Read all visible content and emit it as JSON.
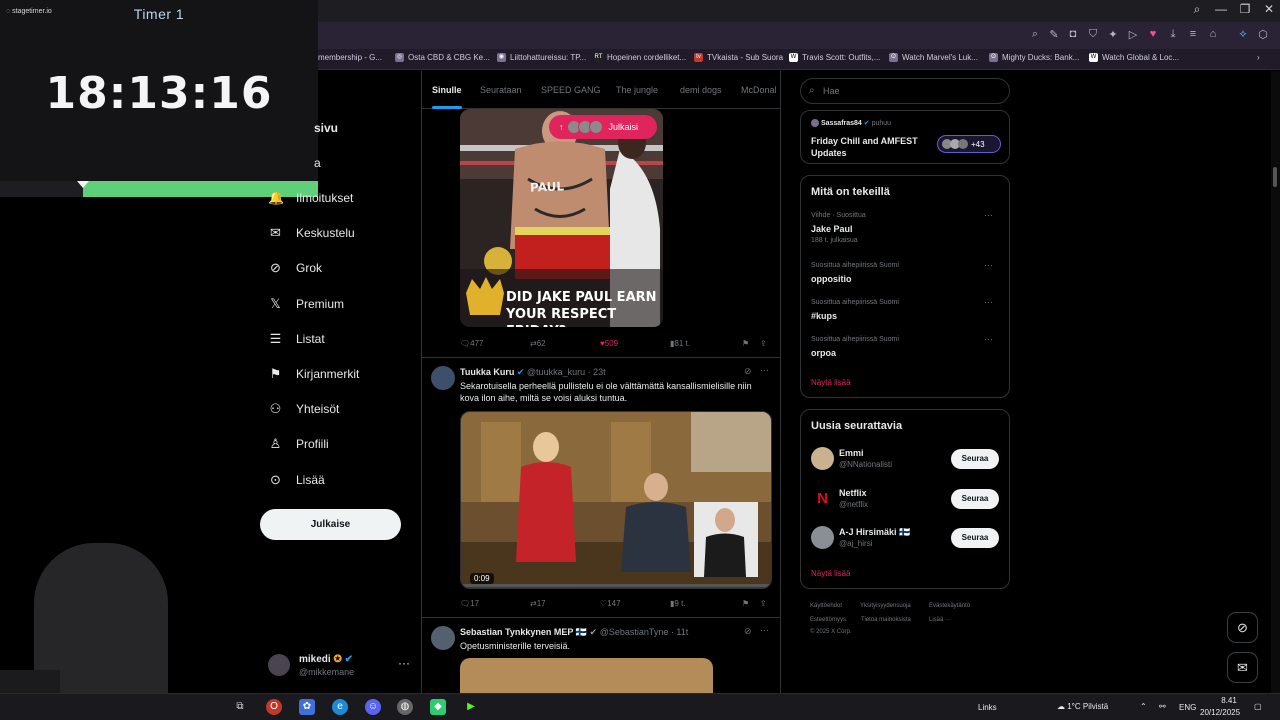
{
  "browser": {
    "bookmarks": [
      {
        "label": "membership - G..."
      },
      {
        "label": "Osta CBD & CBG Ke..."
      },
      {
        "label": "Liittohattureissu: TP..."
      },
      {
        "label": "Hopeinen cordelliket..."
      },
      {
        "label": "TVkaista - Sub Suora"
      },
      {
        "label": "Travis Scott: Outfits,..."
      },
      {
        "label": "Watch Marvel's Luk..."
      },
      {
        "label": "Mighty Ducks: Bank..."
      },
      {
        "label": "Watch Global & Loc..."
      }
    ],
    "window_controls": {
      "minimize": "—",
      "maximize": "❐",
      "close": "✕"
    }
  },
  "timer": {
    "brand": "stagetimer.io",
    "name": "Timer 1",
    "time": "18:13:16",
    "progress_fraction": 0.74,
    "accent_color": "#5fd07a"
  },
  "nav": {
    "partial_top": "sivu",
    "partial_second": "a",
    "items": [
      {
        "label": "Ilmoitukset",
        "icon": "bell-icon",
        "glyph": "🔔"
      },
      {
        "label": "Keskustelu",
        "icon": "mail-icon",
        "glyph": "✉"
      },
      {
        "label": "Grok",
        "icon": "grok-icon",
        "glyph": "⊘"
      },
      {
        "label": "Premium",
        "icon": "x-logo-icon",
        "glyph": "𝕏"
      },
      {
        "label": "Listat",
        "icon": "list-icon",
        "glyph": "☰"
      },
      {
        "label": "Kirjanmerkit",
        "icon": "bookmark-icon",
        "glyph": "⚑"
      },
      {
        "label": "Yhteisöt",
        "icon": "communities-icon",
        "glyph": "⚇"
      },
      {
        "label": "Profiili",
        "icon": "profile-icon",
        "glyph": "♙"
      },
      {
        "label": "Lisää",
        "icon": "more-circle-icon",
        "glyph": "⊙"
      }
    ],
    "post_button": "Julkaise",
    "account": {
      "name": "mikedi",
      "handle": "@mikkemane",
      "more": "···"
    }
  },
  "feed": {
    "tabs": [
      "Sinulle",
      "Seurataan",
      "SPEED GANG",
      "The jungle",
      "demi dogs",
      "McDonal"
    ],
    "new_posts_pill": "Julkaisi",
    "tweet1": {
      "image_caption_line1": "DID JAKE PAUL EARN",
      "image_caption_line2": "YOUR RESPECT FRIDAY?",
      "trunks_text": "PAUL",
      "replies": "477",
      "reposts": "62",
      "likes": "509",
      "views": "81 t."
    },
    "tweet2": {
      "name": "Tuukka Kuru",
      "handle": "@tuukka_kuru · 23t",
      "text": "Sekarotuisella perheellä pullistelu ei ole välttämättä kansallismielisille niin kova ilon aihe, miltä se voisi aluksi tuntua.",
      "video_time": "0:09",
      "replies": "17",
      "reposts": "17",
      "likes": "147",
      "views": "9 t."
    },
    "tweet3": {
      "name": "Sebastian Tynkkynen MEP",
      "flag": "🇫🇮",
      "handle": "@SebastianTyne · 11t",
      "text": "Opetusministerille terveisiä."
    }
  },
  "right": {
    "search_placeholder": "Hae",
    "space": {
      "host": "Sassafras84",
      "host_status": "puhuu",
      "title_line1": "Friday Chill and AMFEST",
      "title_line2": "Updates",
      "listeners": "+43"
    },
    "trends_title": "Mitä on tekeillä",
    "trends": [
      {
        "context": "Viihde · Suosittua",
        "name": "Jake Paul",
        "count": "188 t. julkaisua"
      },
      {
        "context": "Suosittua aihepiirissä Suomi",
        "name": "oppositio",
        "count": ""
      },
      {
        "context": "Suosittua aihepiirissä Suomi",
        "name": "#kups",
        "count": ""
      },
      {
        "context": "Suosittua aihepiirissä Suomi",
        "name": "orpoa",
        "count": ""
      }
    ],
    "trends_more": "Näytä lisää",
    "follow_title": "Uusia seurattavia",
    "follow": [
      {
        "name": "Emmi",
        "handle": "@NNationalisti",
        "button": "Seuraa"
      },
      {
        "name": "Netflix",
        "handle": "@netflix",
        "button": "Seuraa"
      },
      {
        "name": "A-J Hirsimäki 🇫🇮",
        "handle": "@aj_hirsi",
        "button": "Seuraa"
      }
    ],
    "follow_more": "Näytä lisää",
    "footer": [
      "Käyttöehdot",
      "Yksityisyydensuoja",
      "Evästekäytäntö",
      "Esteettömyys",
      "Tietoa mainoksista",
      "Lisää ···",
      "© 2025 X Corp."
    ]
  },
  "taskbar": {
    "links_label": "Links",
    "weather": "1°C Pilvistä",
    "lang": "ENG",
    "time": "8.41",
    "date": "20/12/2025"
  },
  "colors": {
    "accent_pink": "#e0245e",
    "x_blue": "#1d9bf0",
    "timer_green": "#5fd07a"
  }
}
